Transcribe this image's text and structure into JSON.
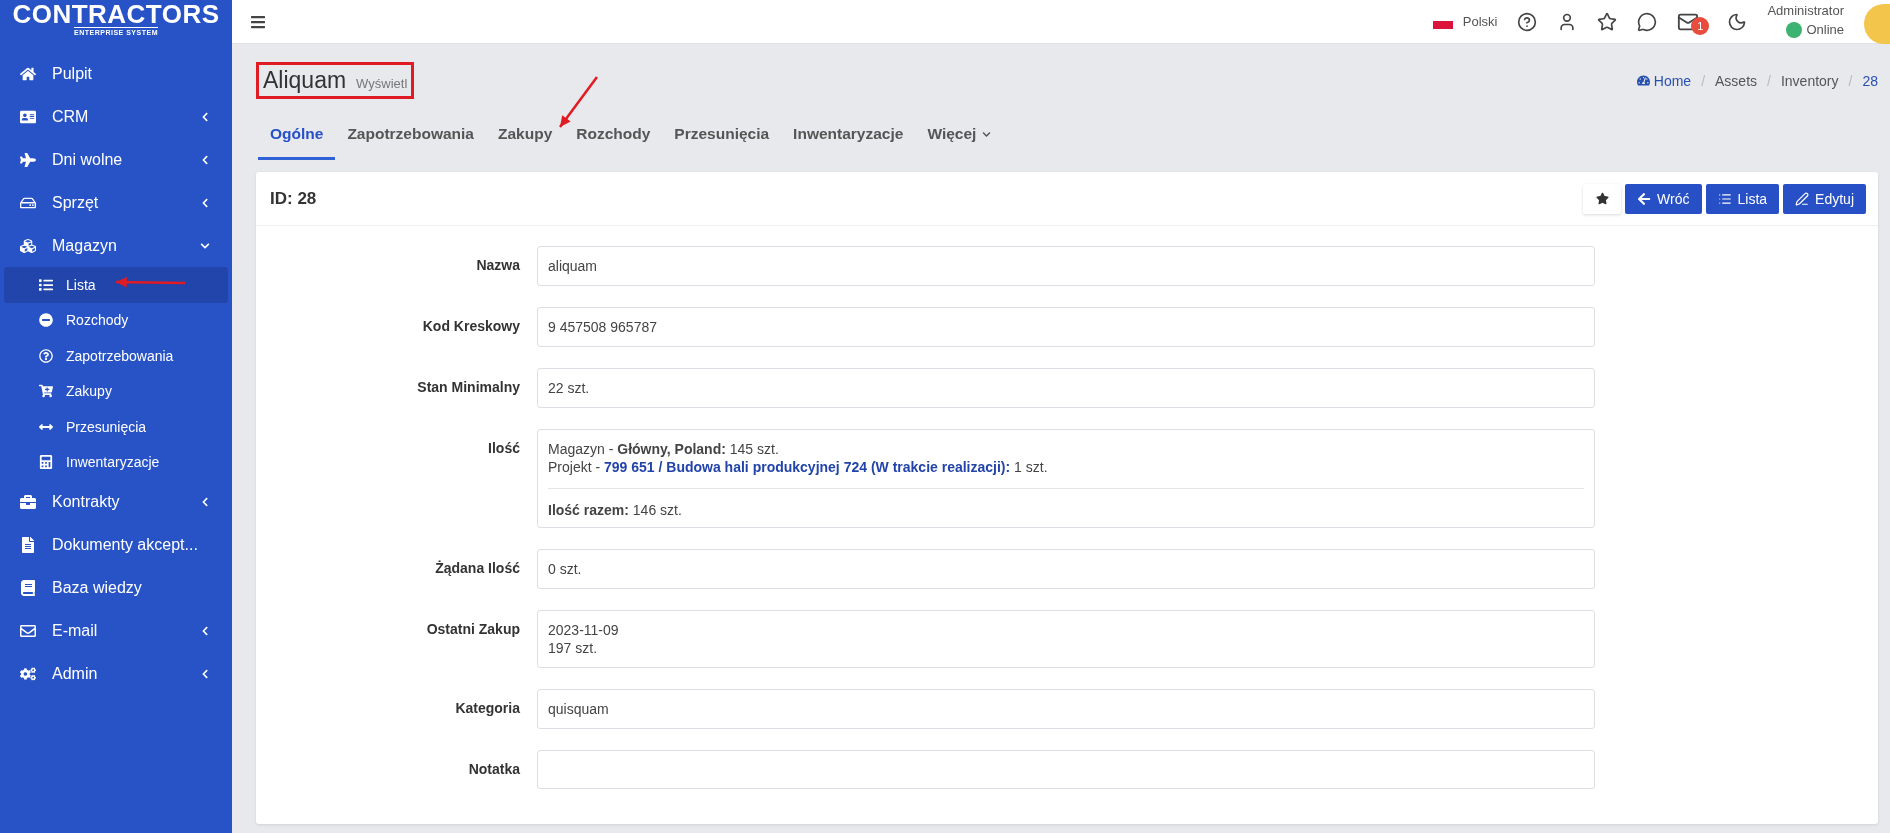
{
  "logo": {
    "name": "CONTRACTORS",
    "tagline": "ENTERPRISE SYSTEM"
  },
  "sidebar": {
    "items": [
      {
        "label": "Pulpit",
        "expandable": false
      },
      {
        "label": "CRM",
        "expandable": true,
        "expanded": false
      },
      {
        "label": "Dni wolne",
        "expandable": true,
        "expanded": false
      },
      {
        "label": "Sprzęt",
        "expandable": true,
        "expanded": false
      },
      {
        "label": "Magazyn",
        "expandable": true,
        "expanded": true,
        "children": [
          {
            "label": "Lista",
            "selected": true
          },
          {
            "label": "Rozchody",
            "selected": false
          },
          {
            "label": "Zapotrzebowania",
            "selected": false
          },
          {
            "label": "Zakupy",
            "selected": false
          },
          {
            "label": "Przesunięcia",
            "selected": false
          },
          {
            "label": "Inwentaryzacje",
            "selected": false
          }
        ]
      },
      {
        "label": "Kontrakty",
        "expandable": true,
        "expanded": false
      },
      {
        "label": "Dokumenty akcept...",
        "expandable": false
      },
      {
        "label": "Baza wiedzy",
        "expandable": false
      },
      {
        "label": "E-mail",
        "expandable": true,
        "expanded": false
      },
      {
        "label": "Admin",
        "expandable": true,
        "expanded": false
      }
    ]
  },
  "topbar": {
    "language": "Polski",
    "mail_count": "1",
    "user": "Administrator",
    "status": "Online"
  },
  "page": {
    "title": "Aliquam",
    "subtitle": "Wyświetl"
  },
  "breadcrumb": [
    {
      "label": "Home",
      "kind": "link"
    },
    {
      "separator": "/",
      "label": "Assets",
      "kind": "text"
    },
    {
      "separator": "/",
      "label": "Inventory",
      "kind": "text"
    },
    {
      "separator": "/",
      "label": "28",
      "kind": "current"
    }
  ],
  "tabs": [
    {
      "label": "Ogólne",
      "selected": true,
      "kind": "tab"
    },
    {
      "label": "Zapotrzebowania",
      "selected": false,
      "kind": "tab"
    },
    {
      "label": "Zakupy",
      "selected": false,
      "kind": "tab"
    },
    {
      "label": "Rozchody",
      "selected": false,
      "kind": "tab"
    },
    {
      "label": "Przesunięcia",
      "selected": false,
      "kind": "tab"
    },
    {
      "label": "Inwentaryzacje",
      "selected": false,
      "kind": "tab"
    },
    {
      "label": "Więcej",
      "selected": false,
      "kind": "dropdown"
    }
  ],
  "card": {
    "title": "ID: 28",
    "buttons": [
      {
        "label": "Wróć",
        "kind": "back"
      },
      {
        "label": "Lista",
        "kind": "list"
      },
      {
        "label": "Edytuj",
        "kind": "edit"
      }
    ]
  },
  "fields": [
    {
      "label": "Nazwa",
      "kind": "text",
      "value": "aliquam"
    },
    {
      "label": "Kod Kreskowy",
      "kind": "text",
      "value": "9 457508 965787"
    },
    {
      "label": "Stan Minimalny",
      "kind": "text",
      "value": "22 szt."
    },
    {
      "label": "Ilość",
      "kind": "stock",
      "lines": [
        {
          "prefix": "Magazyn -",
          "name": "Główny, Poland:",
          "qty": "145 szt.",
          "kind": "plain"
        },
        {
          "prefix": "Projekt -",
          "name": "799 651 / Budowa hali produkcyjnej 724 (W trakcie realizacji):",
          "qty": "1 szt.",
          "kind": "link"
        }
      ],
      "total_label": "Ilość razem:",
      "total": "146 szt."
    },
    {
      "label": "Żądana Ilość",
      "kind": "text",
      "value": "0 szt."
    },
    {
      "label": "Ostatni Zakup",
      "kind": "lines",
      "lines": [
        "2023-11-09",
        "197 szt."
      ]
    },
    {
      "label": "Kategoria",
      "kind": "text",
      "value": "quisquam"
    },
    {
      "label": "Notatka",
      "kind": "text"
    }
  ]
}
